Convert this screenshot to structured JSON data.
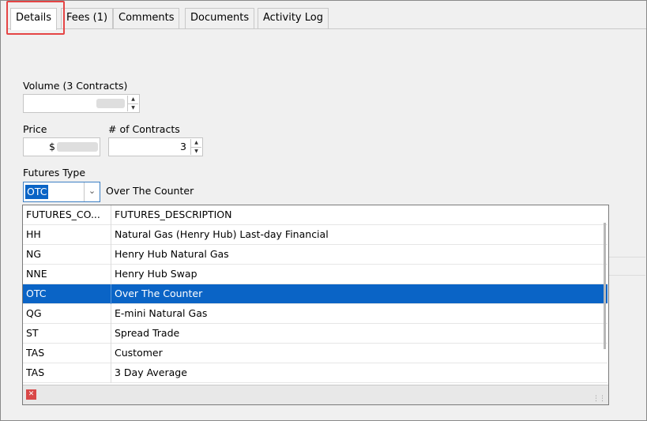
{
  "tabs": [
    {
      "label": "Details"
    },
    {
      "label": "Fees (1)"
    },
    {
      "label": "Comments"
    },
    {
      "label": "Documents"
    },
    {
      "label": "Activity Log"
    }
  ],
  "active_tab": "Details",
  "form": {
    "volume_label": "Volume (3 Contracts)",
    "price_label": "Price",
    "price_prefix": "$",
    "contracts_label": "# of Contracts",
    "contracts_value": "3",
    "futures_type_label": "Futures Type",
    "futures_type_value": "OTC",
    "futures_type_description": "Over The Counter"
  },
  "dropdown": {
    "columns": [
      "FUTURES_CO...",
      "FUTURES_DESCRIPTION"
    ],
    "rows": [
      {
        "code": "HH",
        "description": "Natural Gas (Henry Hub) Last-day Financial"
      },
      {
        "code": "NG",
        "description": "Henry Hub Natural Gas"
      },
      {
        "code": "NNE",
        "description": "Henry Hub Swap"
      },
      {
        "code": "OTC",
        "description": "Over The Counter"
      },
      {
        "code": "QG",
        "description": "E-mini Natural Gas"
      },
      {
        "code": "ST",
        "description": "Spread Trade"
      },
      {
        "code": "TAS",
        "description": "Customer"
      },
      {
        "code": "TAS",
        "description": "3 Day Average"
      }
    ],
    "selected_code": "OTC"
  },
  "icons": {
    "spin_up": "up-arrow",
    "spin_down": "down-arrow",
    "combo": "chevron-down-icon",
    "close": "close-icon",
    "resize": "resize-grip-icon"
  },
  "colors": {
    "selection": "#0a64c6",
    "highlight_box": "#e54545"
  }
}
